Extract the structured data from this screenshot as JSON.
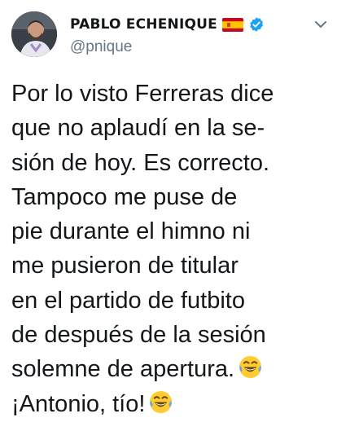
{
  "author": {
    "name": "PABLO ECHENIQUE",
    "handle": "@pnique",
    "avatar_icon": "profile-photo",
    "flag_icon": "spain-flag-icon",
    "verified_icon": "verified-badge-icon",
    "verified_color": "#1da1f2"
  },
  "tweet": {
    "lines": [
      "Por lo visto Ferreras dice",
      "que no aplaudí en la se-",
      "sión de hoy. Es correcto.",
      "Tampoco me puse de",
      "pie durante el himno ni",
      "me pusieron de titular",
      "en el partido de futbito",
      "de después de la sesión",
      "solemne de apertura.",
      "¡Antonio, tío!"
    ],
    "emoji": "face-with-tears-of-joy"
  },
  "menu": {
    "icon": "chevron-down-icon"
  },
  "colors": {
    "text": "#14171a",
    "secondary": "#657786"
  }
}
